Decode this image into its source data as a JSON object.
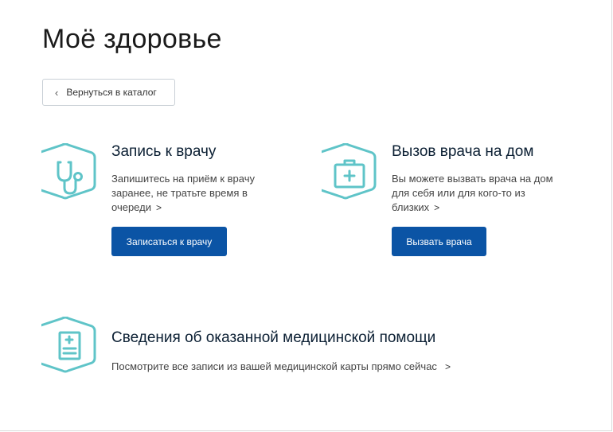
{
  "page": {
    "title": "Моё здоровье"
  },
  "back_button": {
    "label": "Вернуться в каталог"
  },
  "services": {
    "doctor": {
      "title": "Запись к врачу",
      "description": "Запишитесь на приём к врачу заранее, не тратьте время в очереди",
      "button": "Записаться к врачу",
      "icon": "stethoscope-icon"
    },
    "home": {
      "title": "Вызов врача на дом",
      "description": "Вы можете вызвать врача на дом для себя или для кого-то из близких",
      "button": "Вызвать врача",
      "icon": "medical-kit-icon"
    },
    "records": {
      "title": "Сведения об оказанной медицинской помощи",
      "description": "Посмотрите все записи из вашей медицинской карты прямо сейчас",
      "icon": "medical-record-icon"
    }
  },
  "colors": {
    "accent": "#0b54a5",
    "icon": "#5fc4c8"
  }
}
